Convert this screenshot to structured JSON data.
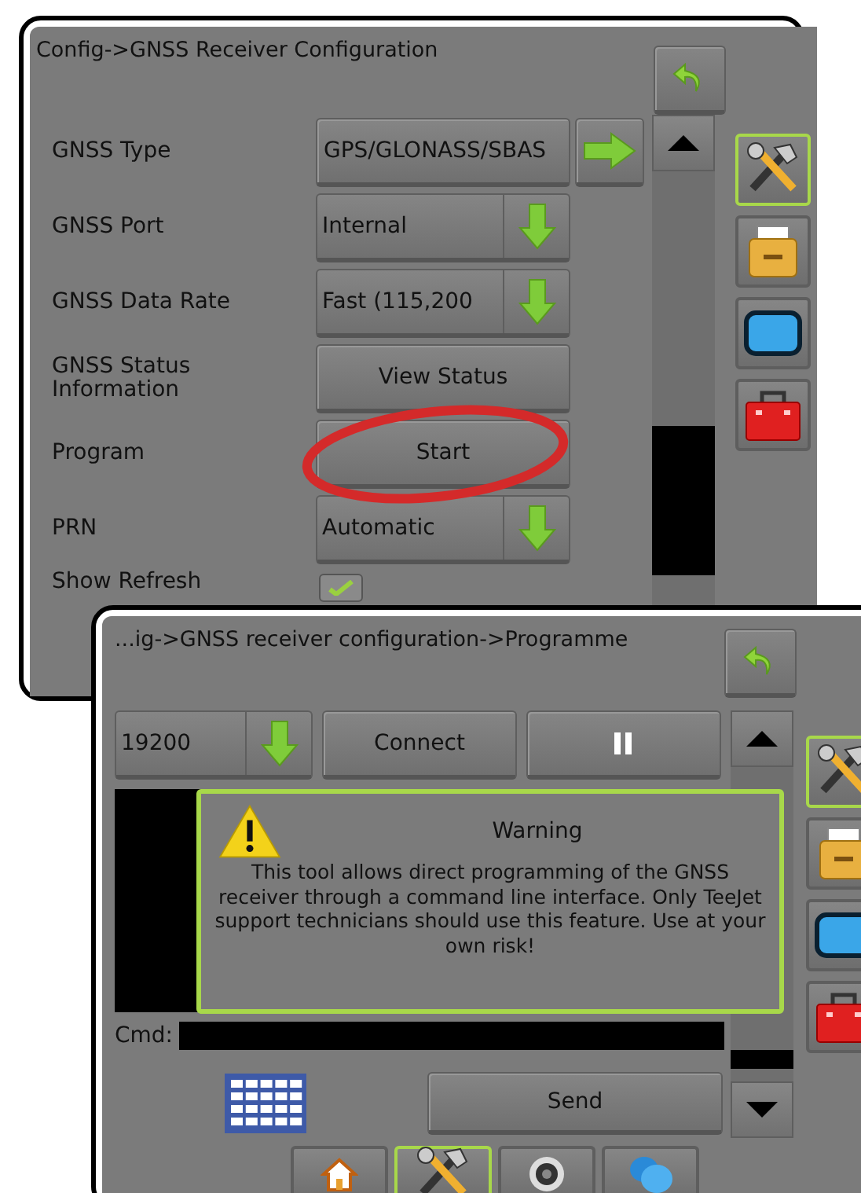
{
  "windows": [
    {
      "title": "Config->GNSS Receiver Configuration",
      "rows": [
        {
          "kind": "select",
          "label": "GNSS Type",
          "value": "GPS/GLONASS/SBAS"
        },
        {
          "kind": "dropdown",
          "label": "GNSS Port",
          "value": "Internal"
        },
        {
          "kind": "dropdown",
          "label": "GNSS Data Rate",
          "value": "Fast (115,200"
        },
        {
          "kind": "button",
          "label": "GNSS Status Information",
          "value": "View Status"
        },
        {
          "kind": "button",
          "label": "Program",
          "value": "Start"
        },
        {
          "kind": "dropdown",
          "label": "PRN",
          "value": "Automatic"
        },
        {
          "kind": "checkbox",
          "label": "Show Refresh",
          "checked": true
        }
      ],
      "side_tabs": [
        {
          "selected": true
        },
        {
          "selected": false
        },
        {
          "selected": false
        },
        {
          "selected": false
        }
      ]
    },
    {
      "title": "...ig->GNSS receiver configuration->Programme",
      "baud": "19200",
      "connect": "Connect",
      "warning": {
        "title": "Warning",
        "message": "This tool allows direct programming of the GNSS receiver through a command line interface. Only TeeJet support technicians should use this feature. Use at your own risk!"
      },
      "cmd_label": "Cmd:",
      "send": "Send",
      "side_tabs": [
        {
          "selected": true
        },
        {
          "selected": false
        },
        {
          "selected": false
        },
        {
          "selected": false
        }
      ],
      "bottom_tabs": [
        {
          "selected": false
        },
        {
          "selected": true
        },
        {
          "selected": false
        },
        {
          "selected": false
        }
      ]
    }
  ]
}
